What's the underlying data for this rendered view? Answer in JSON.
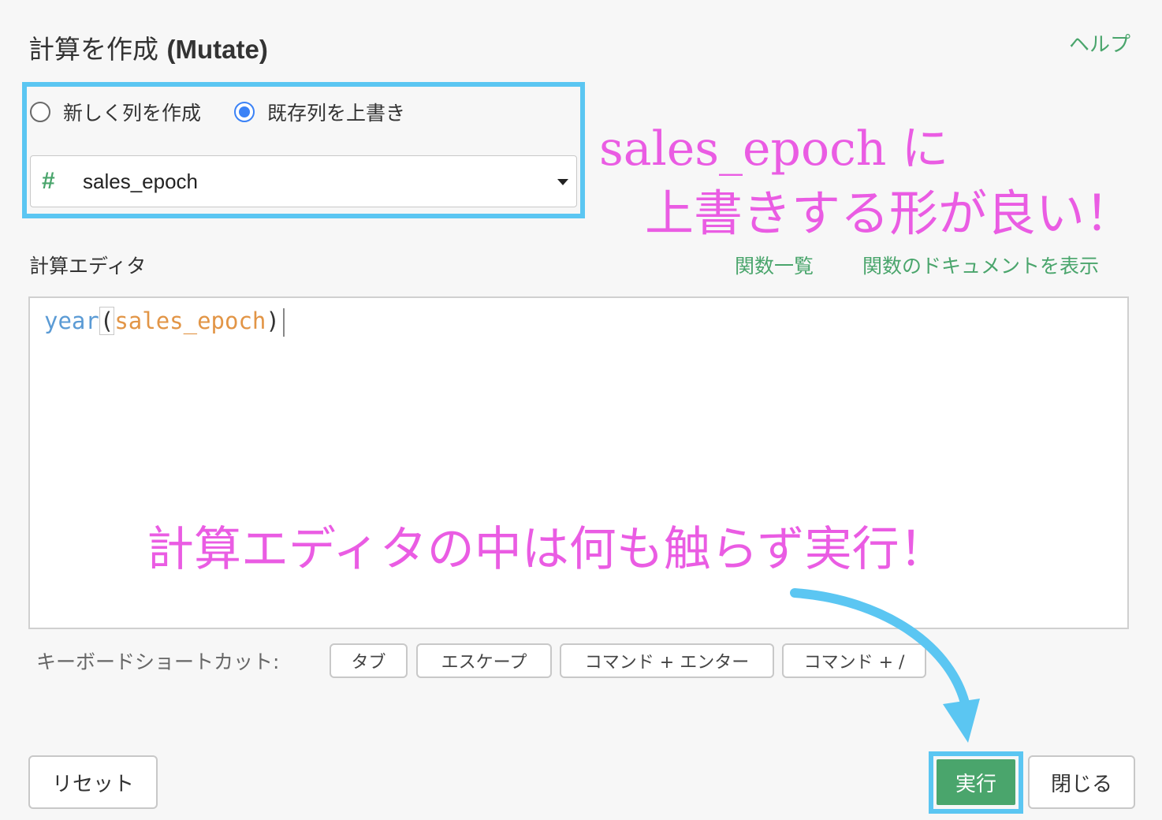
{
  "header": {
    "title_ja": "計算を作成",
    "title_en": "(Mutate)",
    "help_link": "ヘルプ"
  },
  "mode": {
    "options": [
      {
        "label": "新しく列を作成",
        "selected": false
      },
      {
        "label": "既存列を上書き",
        "selected": true
      }
    ]
  },
  "column_select": {
    "type_icon": "#",
    "value": "sales_epoch"
  },
  "editor": {
    "label": "計算エディタ",
    "function_list_link": "関数一覧",
    "function_docs_link": "関数のドキュメントを表示",
    "code": {
      "func": "year",
      "open_paren": "(",
      "arg": "sales_epoch",
      "close_paren": ")"
    }
  },
  "shortcuts": {
    "label": "キーボードショートカット:",
    "keys": [
      "タブ",
      "エスケープ",
      "コマンド + エンター",
      "コマンド + /"
    ]
  },
  "annotations": {
    "line1": "sales_epoch に",
    "line2": "上書きする形が良い！",
    "line3": "計算エディタの中は何も触らず実行！"
  },
  "footer": {
    "reset_label": "リセット",
    "run_label": "実行",
    "close_label": "閉じる"
  },
  "colors": {
    "accent_green": "#4aa56c",
    "highlight_blue": "#5bc6f2",
    "annotation_pink": "#ea5ce3",
    "radio_blue": "#3b82f6",
    "code_func": "#5b9bd5",
    "code_column": "#e29546"
  }
}
